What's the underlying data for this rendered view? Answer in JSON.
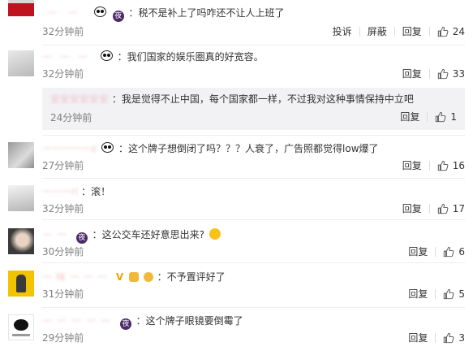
{
  "comments": [
    {
      "name": "一一",
      "text": "：税不是补上了吗咋还不让人上班了",
      "time": "32分钟前",
      "report": "投诉",
      "block": "屏蔽",
      "reply": "回复",
      "likes": "24"
    },
    {
      "name": "一一一",
      "text": "：我们国家的娱乐圈真的好宽容。",
      "time": "32分钟前",
      "reply": "回复",
      "likes": "33",
      "sub": {
        "name": "安安安安安安",
        "text": "：我是觉得不止中国，每个国家都一样，不过我对这种事情保持中立吧",
        "time": "24分钟前",
        "reply": "回复",
        "likes": "1"
      }
    },
    {
      "name": "一一一一一e",
      "text": "：这个牌子想倒闭了吗？？？人衰了，广告照都觉得low爆了",
      "time": "27分钟前",
      "reply": "回复",
      "likes": "16"
    },
    {
      "name": "一一一ri",
      "text": "：滚！",
      "time": "32分钟前",
      "reply": "回复",
      "likes": "17"
    },
    {
      "name": "一一",
      "text": "：这公交车还好意思出来?",
      "time": "30分钟前",
      "reply": "回复",
      "likes": "6"
    },
    {
      "name": "一味一一一",
      "text": "：不予置评好了",
      "time": "31分钟前",
      "reply": "回复",
      "likes": "5"
    },
    {
      "name": "一一一一一",
      "text": "：这个牌子眼镜要倒霉了",
      "time": "29分钟前",
      "reply": "回复",
      "likes": "3"
    }
  ],
  "icons": {
    "badge_letter": "夜",
    "vip_letter": "V"
  },
  "colors": {
    "text": "#333333",
    "meta": "#808080",
    "reply_bg": "#f2f2f5",
    "badge": "#4b2a6b"
  }
}
